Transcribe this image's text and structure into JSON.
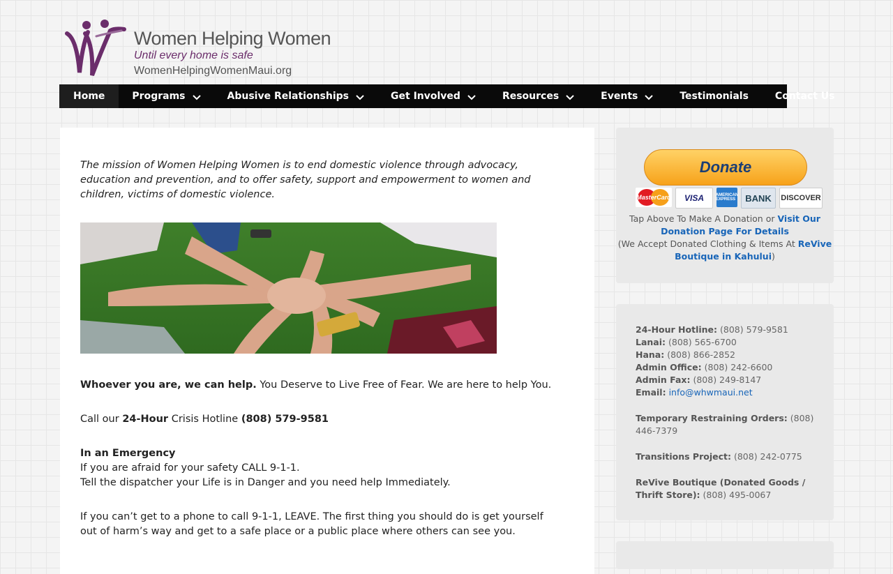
{
  "logo": {
    "title": "Women Helping Women",
    "tagline": "Until every home is safe",
    "url": "WomenHelpingWomenMaui.org"
  },
  "nav": {
    "home": "Home",
    "programs": "Programs",
    "abusive": "Abusive Relationships",
    "get_involved": "Get Involved",
    "resources": "Resources",
    "events": "Events",
    "testimonials": "Testimonials",
    "contact": "Contact Us"
  },
  "main": {
    "mission": "The mission of Women Helping Women is to end domestic violence through advocacy, education and prevention, and to offer safety, support and empowerment to women and children, victims of domestic violence.",
    "help_bold": "Whoever you are, we can help.",
    "help_rest": " You Deserve to Live Free of Fear. We are here to help You.",
    "call_pre": "Call our ",
    "call_bold": "24-Hour",
    "call_mid": " Crisis Hotline ",
    "call_number": "(808) 579-9581",
    "emergency_title": "In an Emergency",
    "emergency_line1": "If you are afraid for your safety CALL 9-1-1.",
    "emergency_line2": "Tell the dispatcher your Life is in Danger and you need help Immediately.",
    "leave_text": "If you can’t get to a phone to call 9-1-1, LEAVE. The first thing you should do is get yourself out of harm’s way and get to a safe place or a public place where others can see you."
  },
  "donate": {
    "button": "Donate",
    "cards": {
      "mastercard": "MasterCard",
      "visa": "VISA",
      "amex": "AMERICAN EXPRESS",
      "bank": "BANK",
      "discover": "DISCOVER"
    },
    "tap_text": "Tap Above To Make A Donation or ",
    "visit_link": "Visit Our Donation Page For Details",
    "accept_text": "(We Accept Donated Clothing & Items At ",
    "boutique_link": "ReVive Boutique in Kahului",
    "close_paren": ")"
  },
  "contact": {
    "hotline_label": "24-Hour Hotline:",
    "hotline": " (808) 579-9581",
    "lanai_label": "Lanai:",
    "lanai": " (808) 565-6700",
    "hana_label": "Hana:",
    "hana": " (808) 866-2852",
    "admin_label": "Admin Office:",
    "admin": " (808) 242-6600",
    "fax_label": "Admin Fax:",
    "fax": " (808) 249-8147",
    "email_label": "Email:",
    "email": "info@whwmaui.net",
    "tro_label": "Temporary Restraining Orders:",
    "tro": " (808) 446-7379",
    "transitions_label": "Transitions Project:",
    "transitions": " (808) 242-0775",
    "revive_label": "ReVive Boutique (Donated Goods / Thrift Store):",
    "revive": " (808) 495-0067"
  },
  "colors": {
    "nav_bg": "#0a0a0a",
    "link": "#1865b8",
    "logo_purple": "#6b2d6b",
    "donate_gold": "#f7a21a"
  }
}
